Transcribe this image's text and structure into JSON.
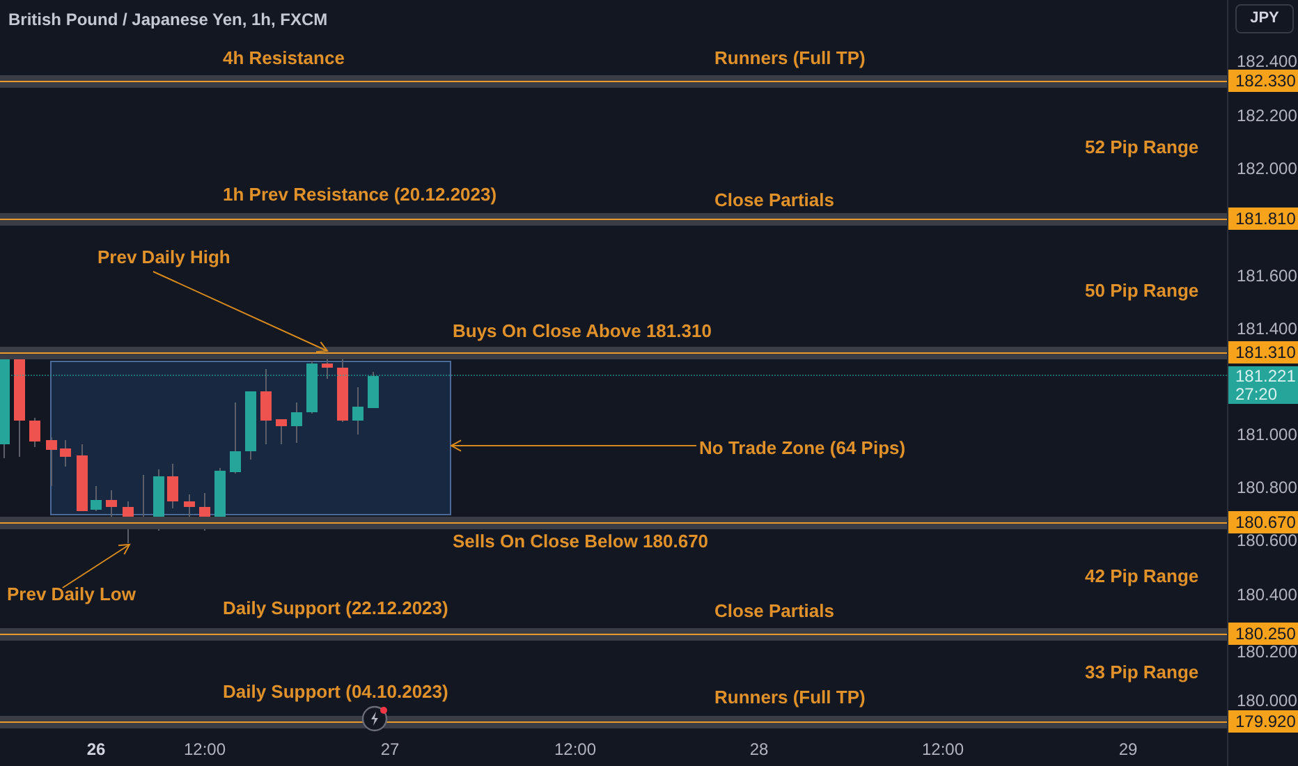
{
  "title": "British Pound / Japanese Yen, 1h, FXCM",
  "currency_button": "JPY",
  "levels": [
    {
      "price_label": "182.330",
      "notes": [
        "4h Resistance",
        "Runners (Full TP)"
      ]
    },
    {
      "price_label": "181.810",
      "notes": [
        "1h Prev Resistance (20.12.2023)",
        "Close Partials"
      ]
    },
    {
      "price_label": "181.310",
      "notes": [
        "Buys On Close Above 181.310"
      ]
    },
    {
      "price_label": "180.670",
      "notes": [
        "Sells On Close Below 180.670"
      ]
    },
    {
      "price_label": "180.250",
      "notes": [
        "Daily Support (22.12.2023)",
        "Close Partials"
      ]
    },
    {
      "price_label": "179.920",
      "notes": [
        "Daily Support (04.10.2023)",
        "Runners (Full TP)"
      ]
    }
  ],
  "range_labels": [
    "52 Pip Range",
    "50 Pip Range",
    "42 Pip Range",
    "33 Pip Range"
  ],
  "annotations": [
    "Prev Daily High",
    "No Trade Zone (64 Pips)",
    "Prev Daily Low"
  ],
  "current_price": {
    "price": "181.221",
    "countdown": "27:20"
  },
  "price_axis": [
    "182.400",
    "182.200",
    "182.000",
    "181.600",
    "181.400",
    "181.000",
    "180.800",
    "180.600",
    "180.400",
    "180.200",
    "180.000"
  ],
  "time_axis": [
    {
      "label": "26",
      "emphasized": true
    },
    {
      "label": "12:00",
      "emphasized": false
    },
    {
      "label": "27",
      "emphasized": false
    },
    {
      "label": "12:00",
      "emphasized": false
    },
    {
      "label": "28",
      "emphasized": false
    },
    {
      "label": "12:00",
      "emphasized": false
    },
    {
      "label": "29",
      "emphasized": false
    }
  ]
}
